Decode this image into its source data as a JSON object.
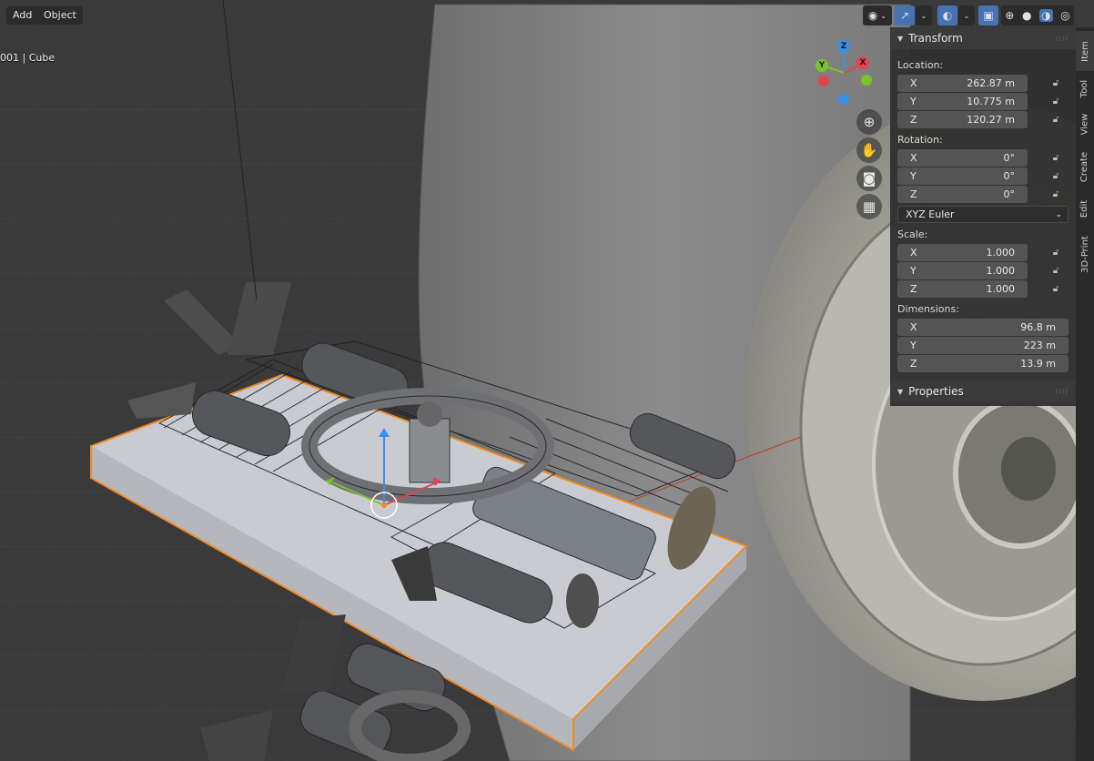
{
  "header": {
    "menus": [
      "Add",
      "Object"
    ],
    "object_label": "001 | Cube"
  },
  "gizmo": {
    "x_label": "X",
    "y_label": "Y",
    "z_label": "Z"
  },
  "navigation_icons": [
    "zoom-icon",
    "pan-hand-icon",
    "camera-icon",
    "grid-perspective-icon"
  ],
  "n_panel": {
    "transform_title": "Transform",
    "location_label": "Location:",
    "location": [
      {
        "axis": "X",
        "value": "262.87 m"
      },
      {
        "axis": "Y",
        "value": "10.775 m"
      },
      {
        "axis": "Z",
        "value": "120.27 m"
      }
    ],
    "rotation_label": "Rotation:",
    "rotation": [
      {
        "axis": "X",
        "value": "0°"
      },
      {
        "axis": "Y",
        "value": "0°"
      },
      {
        "axis": "Z",
        "value": "0°"
      }
    ],
    "rotation_mode": "XYZ Euler",
    "scale_label": "Scale:",
    "scale": [
      {
        "axis": "X",
        "value": "1.000"
      },
      {
        "axis": "Y",
        "value": "1.000"
      },
      {
        "axis": "Z",
        "value": "1.000"
      }
    ],
    "dimensions_label": "Dimensions:",
    "dimensions": [
      {
        "axis": "X",
        "value": "96.8 m"
      },
      {
        "axis": "Y",
        "value": "223 m"
      },
      {
        "axis": "Z",
        "value": "13.9 m"
      }
    ],
    "properties_title": "Properties"
  },
  "side_tabs": [
    "Item",
    "Tool",
    "View",
    "Create",
    "Edit",
    "3D-Print"
  ],
  "colors": {
    "selection_outline": "#f08a24",
    "gizmo_x": "#e8424f",
    "gizmo_y": "#7cc22a",
    "gizmo_z": "#3b8fe8",
    "active_button": "#4772b3"
  }
}
